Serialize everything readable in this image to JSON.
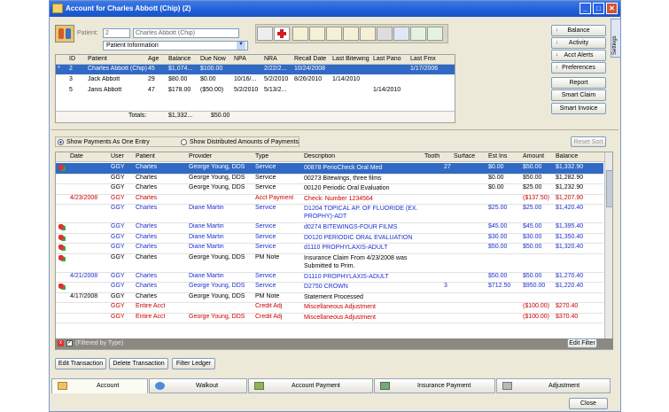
{
  "window": {
    "title": "Account for Charles Abbott (Chip) (2)",
    "minimize": "_",
    "maximize": "□",
    "close": "✕"
  },
  "patient": {
    "label": "Patient:",
    "id": "2",
    "name": "Charles Abbott (Chip)",
    "info_select": "Patient Information"
  },
  "family_table": {
    "headers": [
      "ID",
      "Patient",
      "Age",
      "Balance",
      "Due Now",
      "NPA",
      "NRA",
      "Recall Date",
      "Last Bitewing",
      "Last Pano",
      "Last Fmx"
    ],
    "rows": [
      {
        "mark": "*",
        "cells": [
          "2",
          "Charles Abbott (Chip)",
          "45",
          "$1,074...",
          "$100.00",
          "",
          "2/22/2...",
          "10/24/2008",
          "",
          "",
          "1/17/2006"
        ]
      },
      {
        "mark": "",
        "cells": [
          "3",
          "Jack Abbott",
          "29",
          "$80.00",
          "$0.00",
          "10/16/...",
          "5/2/2010",
          "8/26/2010",
          "1/14/2010",
          "",
          ""
        ]
      },
      {
        "mark": "",
        "cells": [
          "5",
          "Janis Abbott",
          "47",
          "$178.00",
          "($50.00)",
          "5/2/2010",
          "5/13/2...",
          "",
          "",
          "1/14/2010",
          ""
        ]
      }
    ],
    "totals_label": "Totals:",
    "totals_balance": "$1,332...",
    "totals_due": "$50.00"
  },
  "side_buttons": [
    "Balance",
    "Activity",
    "Acct Alerts",
    "Preferences",
    "Report",
    "Smart Claim",
    "Smart Invoice"
  ],
  "side_tab": "Settings",
  "options": {
    "show_payments_one": "Show Payments As One Entry",
    "show_distributed": "Show Distributed Amounts of Payments",
    "reset_sort": "Reset Sort"
  },
  "ledger": {
    "headers": [
      "Date",
      "User",
      "Patient",
      "Provider",
      "Type",
      "Description",
      "Tooth",
      "Surface",
      "Est Ins",
      "Amount",
      "Balance"
    ],
    "rows": [
      {
        "style": "sel",
        "icon": true,
        "cells": [
          "",
          "GGY",
          "Charles",
          "George Young, DDS",
          "Service",
          "00878 PerioCheck Oral Med",
          "27",
          "",
          "$0.00",
          "$50.00",
          "$1,332.90"
        ]
      },
      {
        "style": "",
        "icon": false,
        "cells": [
          "",
          "GGY",
          "Charles",
          "George Young, DDS",
          "Service",
          "00273 Bitewings, three films",
          "",
          "",
          "$0.00",
          "$50.00",
          "$1,282.90"
        ]
      },
      {
        "style": "",
        "icon": false,
        "cells": [
          "",
          "GGY",
          "Charles",
          "George Young, DDS",
          "Service",
          "00120 Periodic Oral Evaluation",
          "",
          "",
          "$0.00",
          "$25.00",
          "$1,232.90"
        ]
      },
      {
        "style": "red",
        "icon": false,
        "cells": [
          "4/23/2008",
          "GGY",
          "Charles",
          "",
          "Acct Payment",
          "Check: Number 1234564",
          "",
          "",
          "",
          "($137.50)",
          "$1,207.90"
        ]
      },
      {
        "style": "blue",
        "icon": false,
        "cells": [
          "",
          "GGY",
          "Charles",
          "Diane Martin",
          "Service",
          "D1204 TOPICAL AP. OF FLUORIDE (EX. PROPHY)-ADT",
          "",
          "",
          "$25.00",
          "$25.00",
          "$1,420.40"
        ]
      },
      {
        "style": "blue",
        "icon": true,
        "cells": [
          "",
          "GGY",
          "Charles",
          "Diane Martin",
          "Service",
          "d0274 BITEWINGS-FOUR FILMS",
          "",
          "",
          "$45.00",
          "$45.00",
          "$1,395.40"
        ]
      },
      {
        "style": "blue",
        "icon": true,
        "cells": [
          "",
          "GGY",
          "Charles",
          "Diane Martin",
          "Service",
          "D0120 PERIODIC ORAL EVALUATION",
          "",
          "",
          "$30.00",
          "$30.00",
          "$1,350.40"
        ]
      },
      {
        "style": "blue",
        "icon": true,
        "cells": [
          "",
          "GGY",
          "Charles",
          "Diane Martin",
          "Service",
          "d1110 PROPHYLAXIS-ADULT",
          "",
          "",
          "$50.00",
          "$50.00",
          "$1,320.40"
        ]
      },
      {
        "style": "",
        "icon": true,
        "cells": [
          "",
          "GGY",
          "Charles",
          "George Young, DDS",
          "PM Note",
          "Insurance Claim From 4/23/2008 was Submitted to Prim.",
          "",
          "",
          "",
          "",
          ""
        ]
      },
      {
        "style": "blue",
        "icon": false,
        "cells": [
          "4/21/2008",
          "GGY",
          "Charles",
          "Diane Martin",
          "Service",
          "D1110 PROPHYLAXIS-ADULT",
          "",
          "",
          "$50.00",
          "$50.00",
          "$1,270.40"
        ]
      },
      {
        "style": "blue",
        "icon": true,
        "cells": [
          "",
          "GGY",
          "Charles",
          "George Young, DDS",
          "Service",
          "D2750 CROWN",
          "3",
          "",
          "$712.50",
          "$950.00",
          "$1,220.40"
        ]
      },
      {
        "style": "",
        "icon": false,
        "cells": [
          "4/17/2008",
          "GGY",
          "Charles",
          "George Young, DDS",
          "PM Note",
          "Statement Processed",
          "",
          "",
          "",
          "",
          ""
        ]
      },
      {
        "style": "red",
        "icon": false,
        "cells": [
          "",
          "GGY",
          "Entire Acct",
          "",
          "Credit Adj",
          "Miscellaneous Adjustment",
          "",
          "",
          "",
          "($100.00)",
          "$270.40"
        ]
      },
      {
        "style": "red",
        "icon": false,
        "cells": [
          "",
          "GGY",
          "Entire Acct",
          "George Young, DDS",
          "Credit Adj",
          "Miscellaneous Adjustment",
          "",
          "",
          "",
          "($100.00)",
          "$370.40"
        ]
      }
    ]
  },
  "filter": {
    "label": "(Filtered by Type)",
    "edit_filter": "Edit Filter"
  },
  "actions": [
    "Edit Transaction",
    "Delete Transaction",
    "Filter Ledger"
  ],
  "bottom_tabs": [
    "Account",
    "Walkout",
    "Account Payment",
    "Insurance Payment",
    "Adjustment"
  ],
  "close_button": "Close"
}
